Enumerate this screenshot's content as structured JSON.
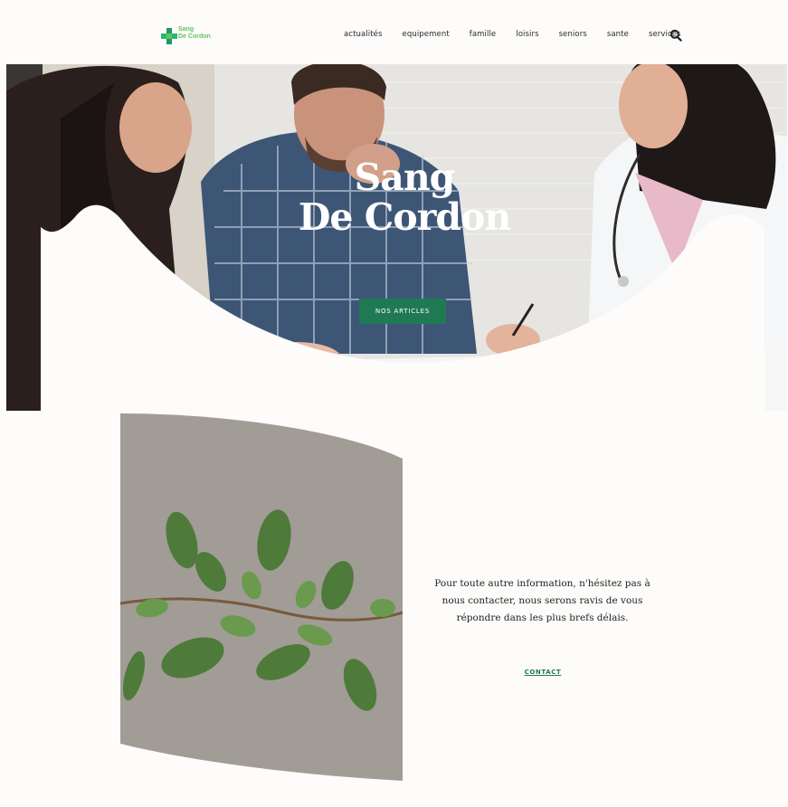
{
  "brand": {
    "line1": "Sang",
    "line2": "De Cordon"
  },
  "nav": {
    "items": [
      "actualités",
      "equipement",
      "famille",
      "loisirs",
      "seniors",
      "sante",
      "services"
    ]
  },
  "hero": {
    "title_line1": "Sang",
    "title_line2": "De Cordon",
    "cta_label": "NOS ARTICLES"
  },
  "info": {
    "text": "Pour toute autre information, n'hésitez pas à nous contacter, nous serons ravis de vous répondre dans les plus brefs délais."
  },
  "contact": {
    "label": "CONTACT"
  },
  "colors": {
    "accent": "#1f7a53",
    "logo": "#62c55b",
    "background": "#fdfcfb"
  }
}
